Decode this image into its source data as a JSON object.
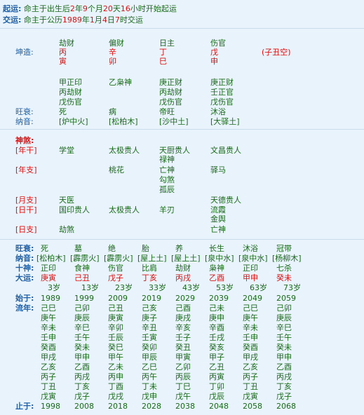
{
  "header": {
    "qiyun_label": "起运:",
    "qiyun_text": [
      "命主于出生后",
      "2",
      "年",
      "9",
      "个月",
      "20",
      "天",
      "16",
      "小时开始起运"
    ],
    "jiaoyun_label": "交运:",
    "jiaoyun_text": [
      "命主于公历",
      "1989",
      "年",
      "1",
      "月",
      "4",
      "日",
      "7",
      "时交运"
    ]
  },
  "pillars": {
    "label": "坤造:",
    "shishen": [
      "劫财",
      "偏财",
      "日主",
      "伤官"
    ],
    "gan": [
      "丙",
      "辛",
      "丁",
      "戊"
    ],
    "zhi": [
      "寅",
      "卯",
      "巳",
      "申"
    ],
    "kong": "(子丑空)",
    "canggan": [
      [
        "甲正印",
        "丙劫财",
        "戊伤官"
      ],
      [
        "乙枭神"
      ],
      [
        "庚正财",
        "丙劫财",
        "戊伤官"
      ],
      [
        "庚正财",
        "壬正官",
        "戊伤官"
      ]
    ],
    "wangshuai_label": "旺衰:",
    "wangshuai": [
      "死",
      "病",
      "帝旺",
      "沐浴"
    ],
    "nayin_label": "纳音:",
    "nayin": [
      "[炉中火]",
      "[松柏木]",
      "[沙中土]",
      "[大驿土]"
    ]
  },
  "shensha": {
    "title": "神煞:",
    "rows": [
      {
        "label": "[年干]",
        "cols": [
          [
            "学堂"
          ],
          [
            "太极贵人"
          ],
          [
            "天厨贵人",
            "禄神"
          ],
          [
            "文昌贵人"
          ]
        ]
      },
      {
        "label": "[年支]",
        "cols": [
          [],
          [
            "桃花"
          ],
          [
            "亡神",
            "勾煞",
            "孤辰"
          ],
          [
            "驿马"
          ]
        ]
      },
      {
        "label": "[月支]",
        "cols": [
          [
            "天医"
          ],
          [],
          [],
          [
            "天德贵人"
          ]
        ]
      },
      {
        "label": "[日干]",
        "cols": [
          [
            "国印贵人"
          ],
          [
            "太极贵人"
          ],
          [
            "羊刃"
          ],
          [
            "流霞",
            "金舆"
          ]
        ]
      },
      {
        "label": "[日支]",
        "cols": [
          [
            "劫煞"
          ],
          [],
          [],
          [
            "亡神"
          ]
        ]
      }
    ]
  },
  "dayun": {
    "wangshuai_label": "旺衰:",
    "wangshuai": [
      "死",
      "墓",
      "绝",
      "胎",
      "养",
      "长生",
      "沐浴",
      "冠带"
    ],
    "nayin_label": "纳音:",
    "nayin": [
      "[松柏木]",
      "[霹雳火]",
      "[霹雳火]",
      "[屋上土]",
      "[屋上土]",
      "[泉中水]",
      "[泉中水]",
      "[杨柳木]"
    ],
    "shishen_label": "十神:",
    "shishen": [
      "正印",
      "食神",
      "伤官",
      "比肩",
      "劫财",
      "枭神",
      "正印",
      "七杀"
    ],
    "dayun_label": "大运:",
    "dayun": [
      "庚寅",
      "己丑",
      "戊子",
      "丁亥",
      "丙戌",
      "乙酉",
      "甲申",
      "癸未"
    ],
    "ages": [
      "3岁",
      "13岁",
      "23岁",
      "33岁",
      "43岁",
      "53岁",
      "63岁",
      "73岁"
    ],
    "shiyu_label": "始于:",
    "shiyu": [
      "1989",
      "1999",
      "2009",
      "2019",
      "2029",
      "2039",
      "2049",
      "2059"
    ],
    "liunian_label": "流年:",
    "liunian": [
      [
        "己巳",
        "庚午",
        "辛未",
        "壬申",
        "癸酉",
        "甲戌",
        "乙亥",
        "丙子",
        "丁丑",
        "戊寅"
      ],
      [
        "己卯",
        "庚辰",
        "辛巳",
        "壬午",
        "癸未",
        "甲申",
        "乙酉",
        "丙戌",
        "丁亥",
        "戊子"
      ],
      [
        "己丑",
        "庚寅",
        "辛卯",
        "壬辰",
        "癸巳",
        "甲午",
        "乙未",
        "丙申",
        "丁酉",
        "戊戌"
      ],
      [
        "己亥",
        "庚子",
        "辛丑",
        "壬寅",
        "癸卯",
        "甲辰",
        "乙巳",
        "丙午",
        "丁未",
        "戊申"
      ],
      [
        "己酉",
        "庚戌",
        "辛亥",
        "壬子",
        "癸丑",
        "甲寅",
        "乙卯",
        "丙辰",
        "丁巳",
        "戊午"
      ],
      [
        "己未",
        "庚申",
        "辛酉",
        "壬戌",
        "癸亥",
        "甲子",
        "乙丑",
        "丙寅",
        "丁卯",
        "戊辰"
      ],
      [
        "己巳",
        "庚午",
        "辛未",
        "壬申",
        "癸酉",
        "甲戌",
        "乙亥",
        "丙子",
        "丁丑",
        "戊寅"
      ],
      [
        "己卯",
        "庚辰",
        "辛巳",
        "壬午",
        "癸未",
        "甲申",
        "乙酉",
        "丙戌",
        "丁亥",
        "戊子"
      ]
    ],
    "zhiyu_label": "止于:",
    "zhiyu": [
      "1998",
      "2008",
      "2018",
      "2028",
      "2038",
      "2048",
      "2058",
      "2068"
    ]
  },
  "colors": {
    "background": "#e8f3fb",
    "label_blue": "#1f5fa6",
    "red": "#dd1111",
    "green": "#1a6a1a"
  }
}
